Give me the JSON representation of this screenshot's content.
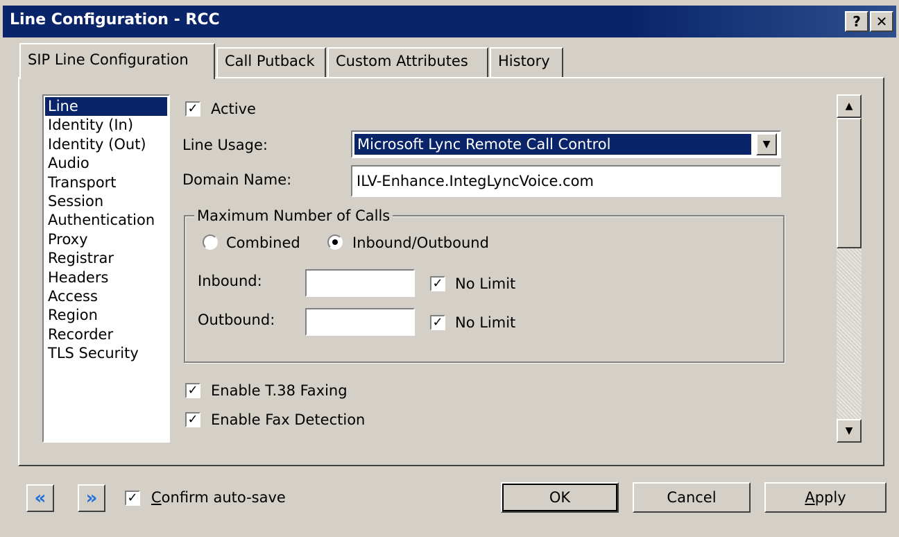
{
  "window": {
    "title": "Line Configuration - RCC",
    "help_label": "?",
    "close_label": "✕"
  },
  "tabs": [
    {
      "label": "SIP Line Configuration",
      "active": true
    },
    {
      "label": "Call Putback"
    },
    {
      "label": "Custom Attributes"
    },
    {
      "label": "History"
    }
  ],
  "sidebar": {
    "items": [
      {
        "label": "Line",
        "selected": true
      },
      {
        "label": "Identity (In)"
      },
      {
        "label": "Identity (Out)"
      },
      {
        "label": "Audio"
      },
      {
        "label": "Transport"
      },
      {
        "label": "Session"
      },
      {
        "label": "Authentication"
      },
      {
        "label": "Proxy"
      },
      {
        "label": "Registrar"
      },
      {
        "label": "Headers"
      },
      {
        "label": "Access"
      },
      {
        "label": "Region"
      },
      {
        "label": "Recorder"
      },
      {
        "label": "TLS Security"
      }
    ]
  },
  "form": {
    "active_label": "Active",
    "active_checked": "✓",
    "line_usage_label": "Line Usage:",
    "line_usage_value": "Microsoft Lync Remote Call Control",
    "domain_name_label": "Domain Name:",
    "domain_name_value": "ILV-Enhance.IntegLyncVoice.com",
    "max_calls": {
      "title": "Maximum Number of Calls",
      "combined_label": "Combined",
      "inbound_outbound_label": "Inbound/Outbound",
      "inbound_label": "Inbound:",
      "inbound_value": "",
      "inbound_nolimit_label": "No Limit",
      "outbound_label": "Outbound:",
      "outbound_value": "",
      "outbound_nolimit_label": "No Limit"
    },
    "t38_label": "Enable T.38 Faxing",
    "fax_detect_label": "Enable Fax Detection",
    "check_mark": "✓"
  },
  "footer": {
    "prev_icon": "«",
    "next_icon": "»",
    "confirm_autosave_rest": "onfirm auto-save",
    "confirm_autosave_accel": "C",
    "ok_label": "OK",
    "cancel_label": "Cancel",
    "apply_accel": "A",
    "apply_rest": "pply"
  },
  "colors": {
    "titlebar": "#0a246a",
    "selection": "#0a246a",
    "nav_arrow": "#1e6fd9"
  }
}
